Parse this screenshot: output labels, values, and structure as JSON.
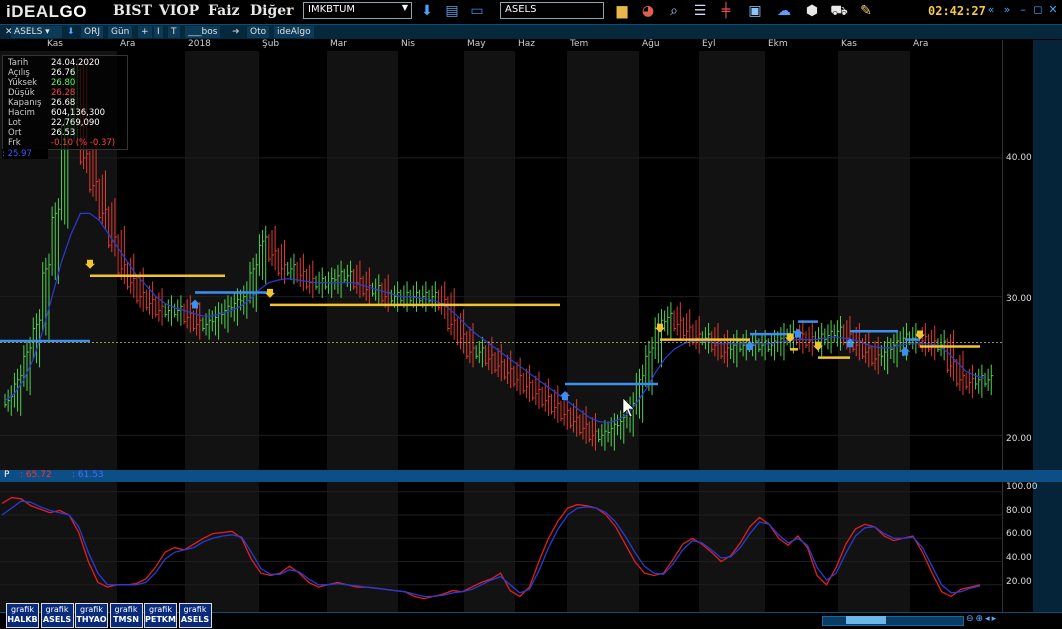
{
  "app": {
    "logo_left": "iDEAL",
    "logo_right": "GO"
  },
  "menu": [
    "BIST",
    "VIOP",
    "Faiz",
    "Diğer"
  ],
  "market_select": {
    "value": "IMKBTUM"
  },
  "symbol_input": {
    "value": "ASELS"
  },
  "clock": "02:42:27",
  "toolbar2": {
    "symbol": "ASELS",
    "items": [
      "ORJ",
      "Gün",
      "+",
      "I",
      "T",
      "___bos",
      "Oto",
      "ideAlgo"
    ]
  },
  "months": [
    "Kas",
    "Ara",
    "2018",
    "Şub",
    "Mar",
    "Nis",
    "May",
    "Haz",
    "Tem",
    "Ağu",
    "Eyl",
    "Ekm",
    "Kas",
    "Ara"
  ],
  "info_panel": {
    "rows": [
      {
        "k": "Tarih",
        "v": "24.04.2020",
        "c": "#ffffff"
      },
      {
        "k": "Açılış",
        "v": "26.76",
        "c": "#ffffff"
      },
      {
        "k": "Yüksek",
        "v": "26.80",
        "c": "#5cff5c"
      },
      {
        "k": "Düşük",
        "v": "26.28",
        "c": "#ff4040"
      },
      {
        "k": "Kapanış",
        "v": "26.68",
        "c": "#ffffff"
      },
      {
        "k": "Hacim",
        "v": "604,136,300",
        "c": "#ffffff"
      },
      {
        "k": "Lot",
        "v": "22,769,090",
        "c": "#ffffff"
      },
      {
        "k": "Ort",
        "v": "26.53",
        "c": "#ffffff"
      },
      {
        "k": "Frk",
        "v": "-0.10 (% -0.37)",
        "c": "#ff4040"
      }
    ],
    "ma_label": ": 25.97"
  },
  "sub_panel": {
    "label": "P",
    "val1": "65.72",
    "val2": "61.53"
  },
  "colors": {
    "up": "#4fd14f",
    "down": "#e03b2e",
    "ma": "#2b3bd6",
    "yellow": "#f2c430",
    "blue": "#3a8ff0",
    "axis_bg": "#06283d"
  },
  "chart_data": [
    {
      "type": "line",
      "name": "price",
      "yticks": [
        20.0,
        30.0,
        40.0
      ],
      "ylim": [
        17.5,
        48.5
      ],
      "series": [
        {
          "name": "close",
          "values": [
            22.5,
            24,
            26,
            28,
            32,
            36,
            42,
            46,
            40,
            38,
            36,
            34,
            32,
            31,
            30,
            29.5,
            29,
            29,
            29,
            28.5,
            28,
            28,
            28.5,
            29,
            29.5,
            30,
            32,
            34,
            33,
            32,
            32,
            31.5,
            31,
            31,
            31,
            31.5,
            31.5,
            31,
            30.5,
            30.5,
            30,
            30,
            30,
            30,
            30,
            30,
            29.5,
            28,
            27,
            26,
            26,
            25.5,
            25,
            24.5,
            24,
            23.5,
            23,
            22.5,
            22,
            21.5,
            21,
            20.5,
            20,
            20,
            20.5,
            21,
            22,
            24,
            26,
            28,
            28.5,
            28,
            27.5,
            27,
            27,
            26.5,
            26,
            26.5,
            26.5,
            26.5,
            26.5,
            26.5,
            27,
            27.2,
            27,
            26.8,
            27,
            27.2,
            27.5,
            27,
            26.5,
            26,
            25.5,
            26,
            26.5,
            27,
            27,
            26.8,
            26.5,
            26.5,
            25,
            24,
            23.8,
            24,
            24
          ]
        },
        {
          "name": "ma",
          "values": [
            22.5,
            23,
            24,
            25.5,
            27.5,
            30,
            32.5,
            34.5,
            36,
            36,
            35.5,
            34.5,
            33.5,
            32.5,
            31.5,
            30.8,
            30,
            29.5,
            29.2,
            29,
            28.8,
            28.6,
            28.6,
            28.8,
            29,
            29.3,
            29.8,
            30.5,
            31,
            31.2,
            31.3,
            31.2,
            31.1,
            31,
            31,
            31,
            31,
            31,
            30.8,
            30.6,
            30.4,
            30.2,
            30,
            30,
            29.9,
            29.8,
            29.6,
            29.2,
            28.6,
            27.9,
            27.3,
            26.8,
            26.3,
            25.8,
            25.3,
            24.8,
            24.3,
            23.8,
            23.3,
            22.8,
            22.3,
            21.8,
            21.3,
            21,
            20.9,
            21.1,
            21.5,
            22.3,
            23.3,
            24.5,
            25.5,
            26.2,
            26.6,
            26.8,
            26.8,
            26.7,
            26.6,
            26.6,
            26.6,
            26.6,
            26.6,
            26.6,
            26.7,
            26.8,
            26.9,
            26.9,
            26.9,
            27,
            27.1,
            27,
            26.9,
            26.7,
            26.4,
            26.3,
            26.3,
            26.5,
            26.6,
            26.6,
            26.6,
            26.5,
            26,
            25.3,
            24.6,
            24.3,
            24.1
          ]
        }
      ],
      "hlines": [
        {
          "color": "yellow",
          "y": 31.5,
          "x0": 0.09,
          "x1": 0.225
        },
        {
          "color": "blue",
          "y": 30.3,
          "x0": 0.195,
          "x1": 0.27
        },
        {
          "color": "yellow",
          "y": 29.4,
          "x0": 0.27,
          "x1": 0.56
        },
        {
          "color": "blue",
          "y": 26.8,
          "x0": 0.0,
          "x1": 0.09
        },
        {
          "color": "blue",
          "y": 23.7,
          "x0": 0.565,
          "x1": 0.658
        },
        {
          "color": "yellow",
          "y": 26.9,
          "x0": 0.66,
          "x1": 0.75
        },
        {
          "color": "blue",
          "y": 27.3,
          "x0": 0.75,
          "x1": 0.79
        },
        {
          "color": "yellow",
          "y": 26.2,
          "x0": 0.79,
          "x1": 0.798
        },
        {
          "color": "blue",
          "y": 28.2,
          "x0": 0.798,
          "x1": 0.818
        },
        {
          "color": "yellow",
          "y": 25.6,
          "x0": 0.818,
          "x1": 0.85
        },
        {
          "color": "blue",
          "y": 27.5,
          "x0": 0.85,
          "x1": 0.898
        },
        {
          "color": "blue",
          "y": 26.9,
          "x0": 0.905,
          "x1": 0.92
        },
        {
          "color": "yellow",
          "y": 26.4,
          "x0": 0.92,
          "x1": 0.98
        }
      ],
      "dashed_y": 26.7
    },
    {
      "type": "line",
      "name": "oscillator",
      "yticks": [
        20.0,
        40.0,
        60.0,
        80.0,
        100.0
      ],
      "ylim": [
        0,
        105
      ],
      "series": [
        {
          "name": "red",
          "values": [
            90,
            95,
            94,
            88,
            85,
            82,
            84,
            80,
            65,
            40,
            22,
            18,
            20,
            20,
            21,
            25,
            35,
            48,
            52,
            50,
            55,
            60,
            64,
            65,
            66,
            60,
            42,
            30,
            28,
            30,
            36,
            30,
            22,
            18,
            20,
            22,
            20,
            18,
            18,
            17,
            16,
            15,
            14,
            10,
            8,
            10,
            12,
            15,
            14,
            18,
            22,
            25,
            30,
            15,
            10,
            18,
            40,
            60,
            75,
            86,
            89,
            88,
            86,
            80,
            70,
            55,
            40,
            30,
            28,
            30,
            42,
            55,
            60,
            55,
            48,
            40,
            45,
            56,
            70,
            78,
            72,
            60,
            54,
            62,
            52,
            28,
            20,
            35,
            55,
            68,
            72,
            70,
            62,
            58,
            60,
            62,
            48,
            30,
            14,
            10,
            16,
            18,
            20
          ]
        },
        {
          "name": "blue",
          "values": [
            80,
            86,
            92,
            91,
            87,
            84,
            82,
            80,
            70,
            48,
            30,
            20,
            20,
            20,
            20,
            22,
            30,
            42,
            48,
            50,
            52,
            57,
            60,
            62,
            63,
            61,
            48,
            34,
            29,
            29,
            33,
            31,
            25,
            20,
            20,
            21,
            20,
            19,
            18,
            17,
            16,
            15,
            14,
            12,
            10,
            10,
            11,
            13,
            14,
            16,
            20,
            24,
            27,
            20,
            13,
            16,
            32,
            52,
            68,
            80,
            86,
            87,
            86,
            82,
            74,
            62,
            48,
            36,
            30,
            29,
            38,
            50,
            58,
            56,
            50,
            43,
            44,
            52,
            64,
            74,
            72,
            63,
            56,
            60,
            54,
            35,
            24,
            30,
            47,
            62,
            69,
            70,
            64,
            60,
            60,
            61,
            52,
            36,
            20,
            13,
            14,
            17,
            19
          ]
        }
      ]
    }
  ],
  "price_axis_labels": [
    "40.00",
    "30.00",
    "20.00"
  ],
  "osc_axis_labels": [
    "100.00",
    "80.00",
    "60.00",
    "40.00",
    "20.00"
  ],
  "bottom_tabs": [
    {
      "top": "grafik",
      "bottom": "HALKB"
    },
    {
      "top": "grafik",
      "bottom": "ASELS"
    },
    {
      "top": "grafik",
      "bottom": "THYAO"
    },
    {
      "top": "grafik",
      "bottom": "TMSN"
    },
    {
      "top": "grafik",
      "bottom": "PETKM"
    },
    {
      "top": "grafik",
      "bottom": "ASELS"
    }
  ]
}
